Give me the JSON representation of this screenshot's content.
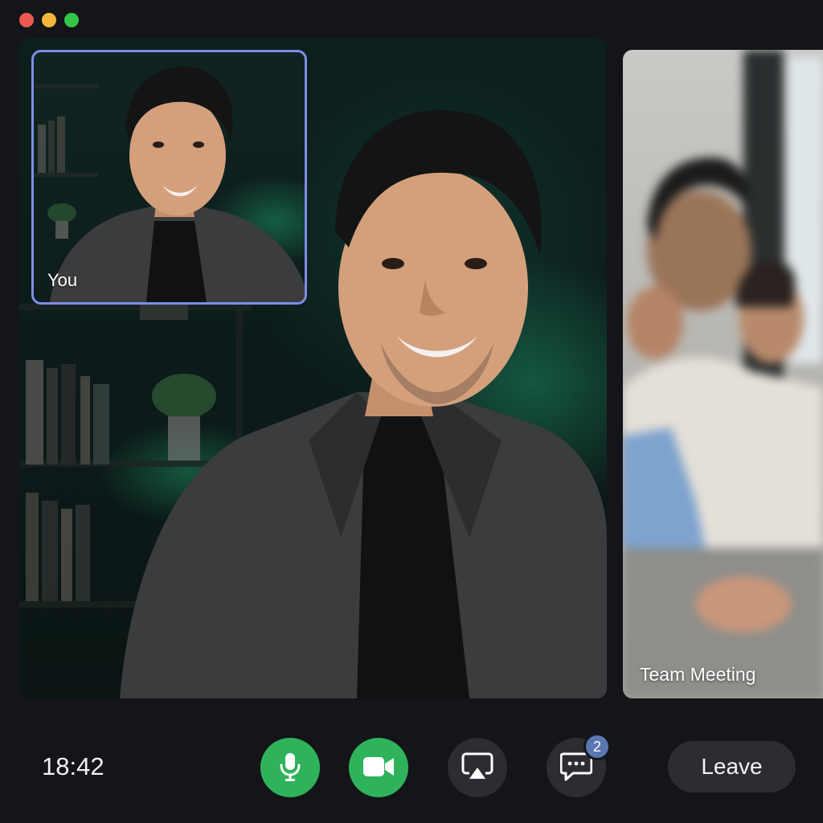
{
  "window": {
    "traffic_lights": {
      "close_color": "#ee5a52",
      "minimize_color": "#f5b73b",
      "maximize_color": "#35c649"
    }
  },
  "self_view": {
    "label": "You",
    "border_color": "#7f8ee6"
  },
  "main_video": {
    "participant": "speaker"
  },
  "side_tile": {
    "label": "Team Meeting"
  },
  "controls": {
    "time": "18:42",
    "mic": {
      "icon": "microphone-icon",
      "state": "on",
      "color": "#2fb35a"
    },
    "camera": {
      "icon": "video-camera-icon",
      "state": "on",
      "color": "#2fb35a"
    },
    "share": {
      "icon": "screen-share-icon"
    },
    "chat": {
      "icon": "chat-bubble-icon",
      "unread": "2"
    },
    "leave_label": "Leave"
  }
}
